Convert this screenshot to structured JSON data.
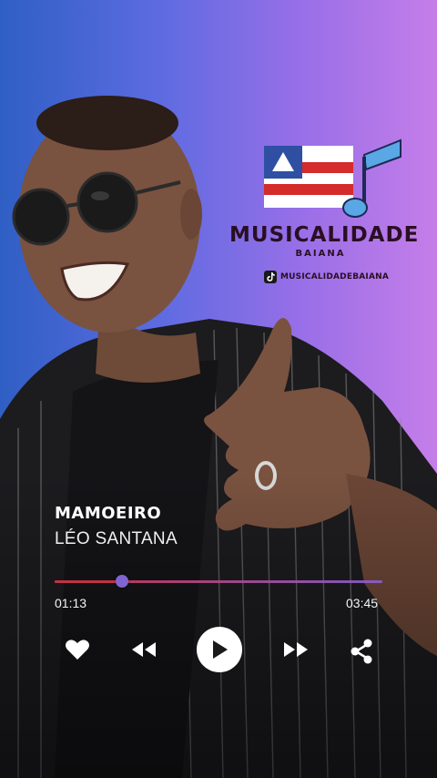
{
  "brand": {
    "title": "MUSICALIDADE",
    "subtitle": "BAIANA",
    "handle": "MUSICALIDADEBAIANA"
  },
  "player": {
    "song_title": "MAMOEIRO",
    "artist": "LÉO SANTANA",
    "current_time": "01:13",
    "total_time": "03:45",
    "progress_fraction": 0.205
  },
  "controls": {
    "like": "heart-icon",
    "previous": "rewind-icon",
    "play": "play-icon",
    "next": "fast-forward-icon",
    "share": "share-icon"
  },
  "colors": {
    "gradient_left": "#2f5fc4",
    "gradient_right": "#c57ee9",
    "progress_played": "#d4364a",
    "progress_thumb": "#8d6fe6",
    "text": "#ffffff"
  }
}
